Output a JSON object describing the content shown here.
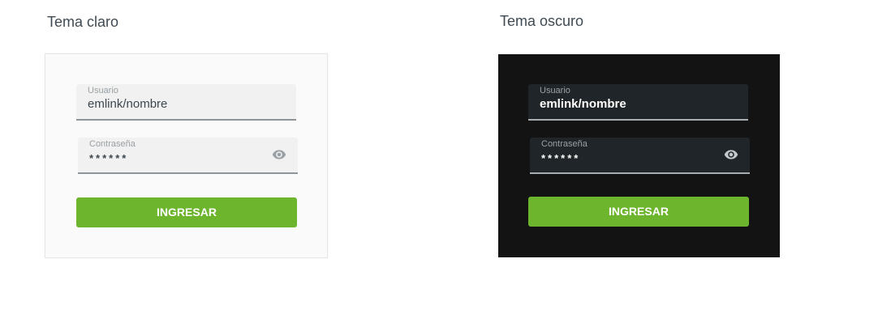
{
  "light": {
    "title": "Tema claro",
    "username": {
      "label": "Usuario",
      "value": "emlink/nombre"
    },
    "password": {
      "label": "Contraseña",
      "value": "******"
    },
    "button_label": "INGRESAR"
  },
  "dark": {
    "title": "Tema oscuro",
    "username": {
      "label": "Usuario",
      "value": "emlink/nombre"
    },
    "password": {
      "label": "Contraseña",
      "value": "******"
    },
    "button_label": "INGRESAR"
  },
  "icons": {
    "password_toggle": "eye-icon"
  },
  "colors": {
    "accent": "#6cb52d",
    "light_background": "#fafafa",
    "light_field": "#f1f1f1",
    "dark_background": "#131313",
    "dark_field": "#1f2529",
    "eye_icon_light": "#9aa0a4",
    "eye_icon_dark": "#c3c8cb"
  }
}
